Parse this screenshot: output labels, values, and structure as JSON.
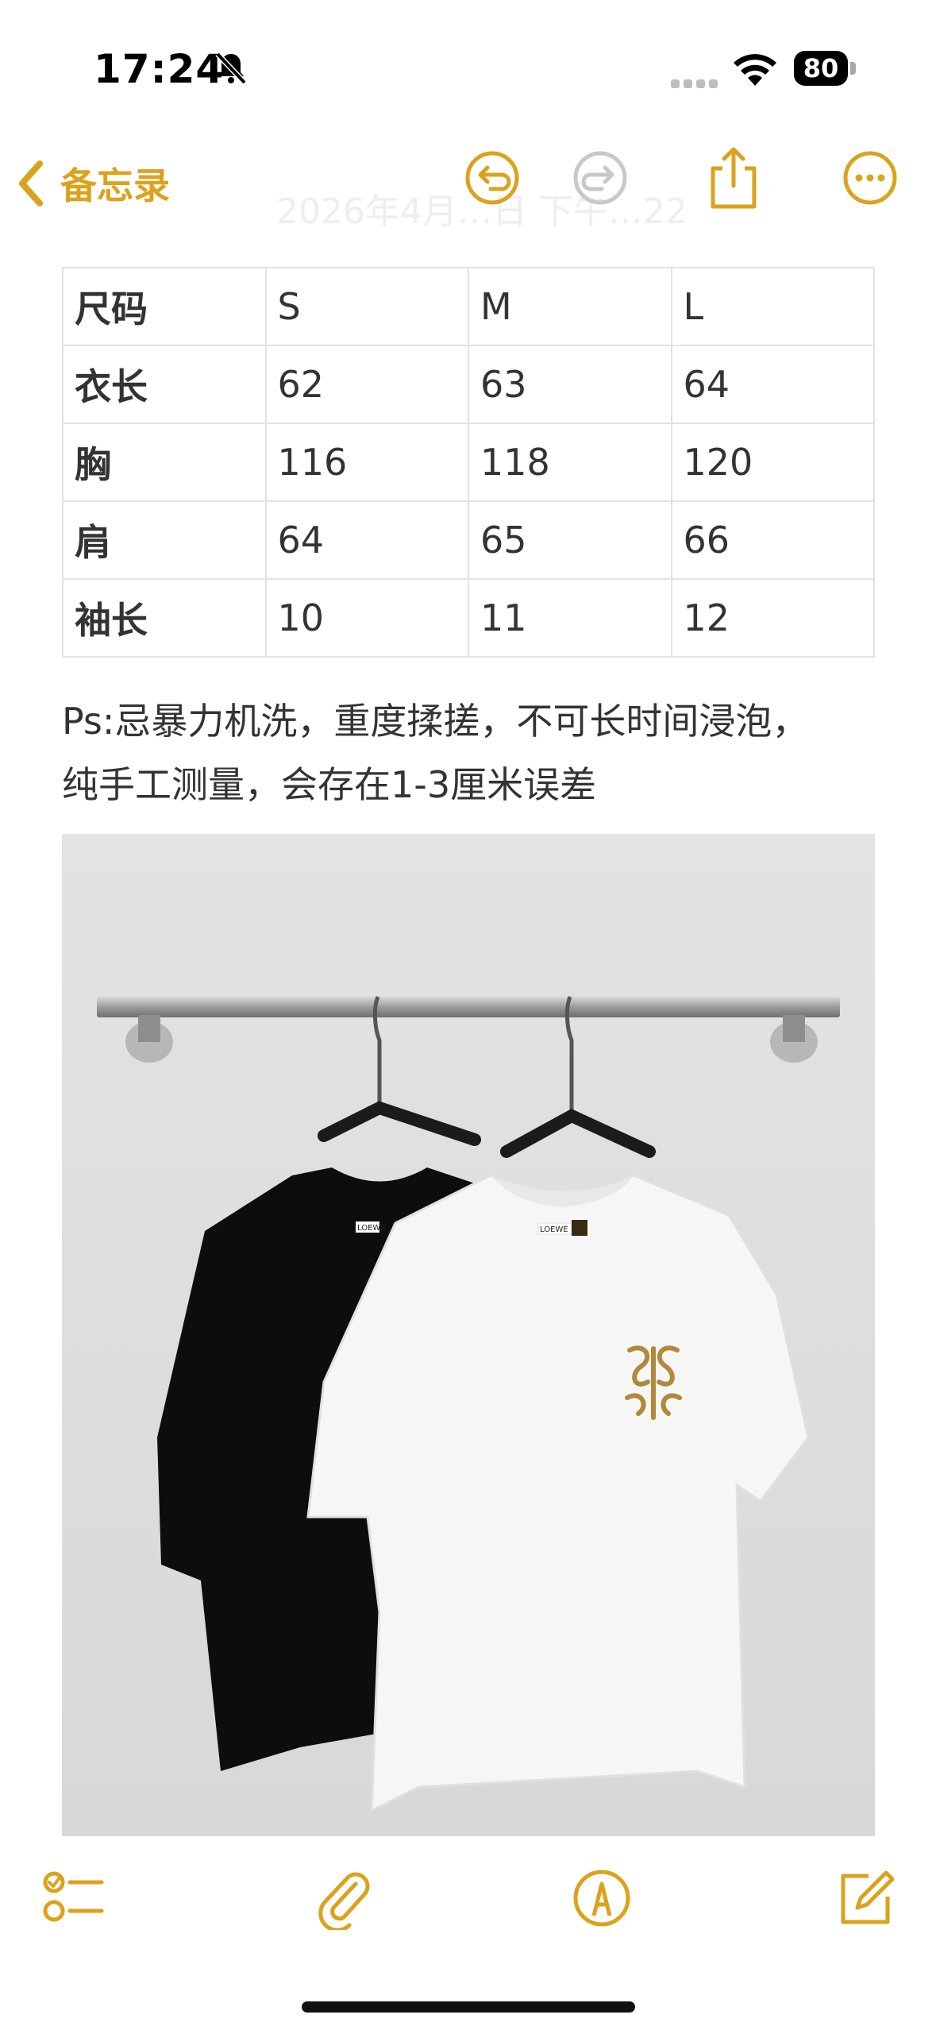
{
  "status": {
    "time": "17:24",
    "battery": "80"
  },
  "nav": {
    "back_label": "备忘录",
    "ghost_date": "2026年4月…日 下午…22"
  },
  "table": {
    "rows": [
      [
        "尺码",
        "S",
        "M",
        "L"
      ],
      [
        "衣长",
        "62",
        "63",
        "64"
      ],
      [
        "胸",
        "116",
        "118",
        "120"
      ],
      [
        "肩",
        "64",
        "65",
        "66"
      ],
      [
        "袖长",
        "10",
        "11",
        "12"
      ]
    ]
  },
  "note": {
    "line1": "Ps:忌暴力机洗，重度揉搓，不可长时间浸泡，",
    "line2": "纯手工测量，会存在1-3厘米误差"
  },
  "photo": {
    "black_tag": "LOEWE",
    "white_tag": "LOEWE"
  },
  "colors": {
    "accent": "#dba21c",
    "disabled": "#c8c8c8"
  },
  "icons": {
    "back": "chevron-left-icon",
    "undo": "undo-icon",
    "redo": "redo-icon",
    "share": "share-icon",
    "more": "more-icon",
    "checklist": "checklist-icon",
    "attach": "paperclip-icon",
    "markup": "markup-pen-icon",
    "compose": "compose-icon"
  }
}
